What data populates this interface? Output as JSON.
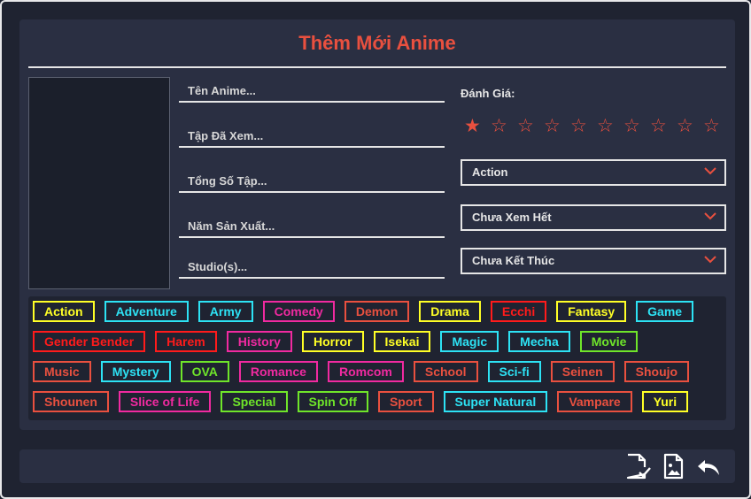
{
  "form": {
    "title": "Thêm Mới Anime",
    "fields": [
      {
        "placeholder": "Tên Anime..."
      },
      {
        "placeholder": "Tập Đã Xem..."
      },
      {
        "placeholder": "Tổng Số Tập..."
      },
      {
        "placeholder": "Năm Sản Xuất..."
      },
      {
        "placeholder": "Studio(s)..."
      }
    ],
    "rating": {
      "label": "Đánh Giá:",
      "value": 1,
      "max": 10,
      "filled_glyph": "★",
      "empty_glyph": "☆"
    },
    "selects": [
      {
        "value": "Action"
      },
      {
        "value": "Chưa Xem Hết"
      },
      {
        "value": "Chưa Kết Thúc"
      }
    ]
  },
  "genres": [
    [
      {
        "label": "Action",
        "color": "#ffff26"
      },
      {
        "label": "Adventure",
        "color": "#2de2f4"
      },
      {
        "label": "Army",
        "color": "#2de2f4"
      },
      {
        "label": "Comedy",
        "color": "#f02aa0"
      },
      {
        "label": "Demon",
        "color": "#e9503f"
      },
      {
        "label": "Drama",
        "color": "#ffff26"
      },
      {
        "label": "Ecchi",
        "color": "#ff1b1b"
      },
      {
        "label": "Fantasy",
        "color": "#ffff26"
      },
      {
        "label": "Game",
        "color": "#2de2f4"
      }
    ],
    [
      {
        "label": "Gender Bender",
        "color": "#ff1b1b"
      },
      {
        "label": "Harem",
        "color": "#ff1b1b"
      },
      {
        "label": "History",
        "color": "#f02aa0"
      },
      {
        "label": "Horror",
        "color": "#ffff26"
      },
      {
        "label": "Isekai",
        "color": "#ffff26"
      },
      {
        "label": "Magic",
        "color": "#2de2f4"
      },
      {
        "label": "Mecha",
        "color": "#2de2f4"
      },
      {
        "label": "Movie",
        "color": "#6fe52a"
      }
    ],
    [
      {
        "label": "Music",
        "color": "#e9503f"
      },
      {
        "label": "Mystery",
        "color": "#2de2f4"
      },
      {
        "label": "OVA",
        "color": "#6fe52a"
      },
      {
        "label": "Romance",
        "color": "#f02aa0"
      },
      {
        "label": "Romcom",
        "color": "#f02aa0"
      },
      {
        "label": "School",
        "color": "#e9503f"
      },
      {
        "label": "Sci-fi",
        "color": "#2de2f4"
      },
      {
        "label": "Seinen",
        "color": "#e9503f"
      },
      {
        "label": "Shoujo",
        "color": "#e9503f"
      }
    ],
    [
      {
        "label": "Shounen",
        "color": "#e9503f"
      },
      {
        "label": "Slice of Life",
        "color": "#f02aa0"
      },
      {
        "label": "Special",
        "color": "#6fe52a"
      },
      {
        "label": "Spin Off",
        "color": "#6fe52a"
      },
      {
        "label": "Sport",
        "color": "#e9503f"
      },
      {
        "label": "Super Natural",
        "color": "#2de2f4"
      },
      {
        "label": "Vampare",
        "color": "#e9503f"
      },
      {
        "label": "Yuri",
        "color": "#ffff26"
      }
    ]
  ],
  "actions": [
    {
      "icon": "file-check-icon"
    },
    {
      "icon": "image-file-icon"
    },
    {
      "icon": "undo-arrow-icon"
    }
  ],
  "colors": {
    "accent": "#e9503f",
    "panel": "#2a2f42",
    "background": "#1f2331",
    "text": "#e6e6e6"
  }
}
